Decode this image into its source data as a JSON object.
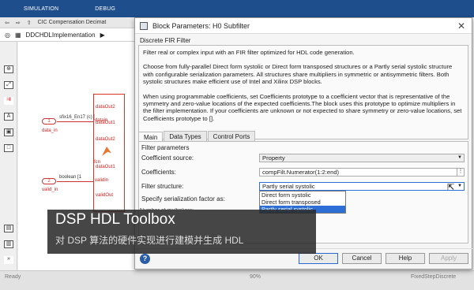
{
  "ribbon": {
    "tabs": [
      "SIMULATION",
      "DEBUG"
    ]
  },
  "nav": {
    "breadcrumb_title": "CIC Compensation Decimat"
  },
  "model": {
    "path": "DDCHDLImplementation"
  },
  "canvas": {
    "port1_num": "1",
    "port1_label": "data_in",
    "port1_type": "sfix16_En17 (c) [",
    "port2_num": "2",
    "port2_label": "valid_in",
    "port2_type": "boolean [1",
    "sig_datain": "datain",
    "sig_validin": "validin",
    "sig_dataout2": "dataOut2",
    "sig_dataout1": "dataOut1",
    "sig_validout": "validOut",
    "fcn_label": "fcn"
  },
  "dialog": {
    "title": "Block Parameters: H0 Subfilter",
    "section": "Discrete FIR Filter",
    "desc1": "Filter real or complex input with an FIR filter optimized for HDL code generation.",
    "desc2": "Choose from fully-parallel Direct form systolic or Direct form transposed structures or a Partly serial systolic structure with configurable serialization parameters. All structures share multipliers in symmetric or antisymmetric filters. Both systolic structures make efficient use of Intel and Xilinx DSP blocks.",
    "desc3": "When using programmable coefficients, set Coefficients prototype to a coefficient vector that is representative of the symmetry and zero-value locations of the expected coefficients.The block uses this prototype to optimize multipliers in the filter implementation. If your coefficients are unknown or not expected to share symmetry or zero-value locations, set Coefficients prototype to [].",
    "tabs": [
      "Main",
      "Data Types",
      "Control Ports"
    ],
    "filter_params": "Filter parameters",
    "coef_source_label": "Coefficient source:",
    "coef_source_value": "Property",
    "coefficients_label": "Coefficients:",
    "coefficients_value": "compFilt.Numerator(1:2:end)",
    "structure_label": "Filter structure:",
    "structure_value": "Partly serial systolic",
    "structure_options": [
      "Direct form systolic",
      "Direct form transposed",
      "Partly serial systolic"
    ],
    "serialization_label": "Specify serialization factor as:",
    "multipliers_label": "Number of multipliers:",
    "buttons": {
      "ok": "OK",
      "cancel": "Cancel",
      "help": "Help",
      "apply": "Apply"
    }
  },
  "caption": {
    "title": "DSP HDL Toolbox",
    "subtitle": "对 DSP 算法的硬件实现进行建模并生成 HDL"
  },
  "status": {
    "left": "Ready",
    "mid": "90%",
    "right": "FixedStepDiscrete"
  }
}
